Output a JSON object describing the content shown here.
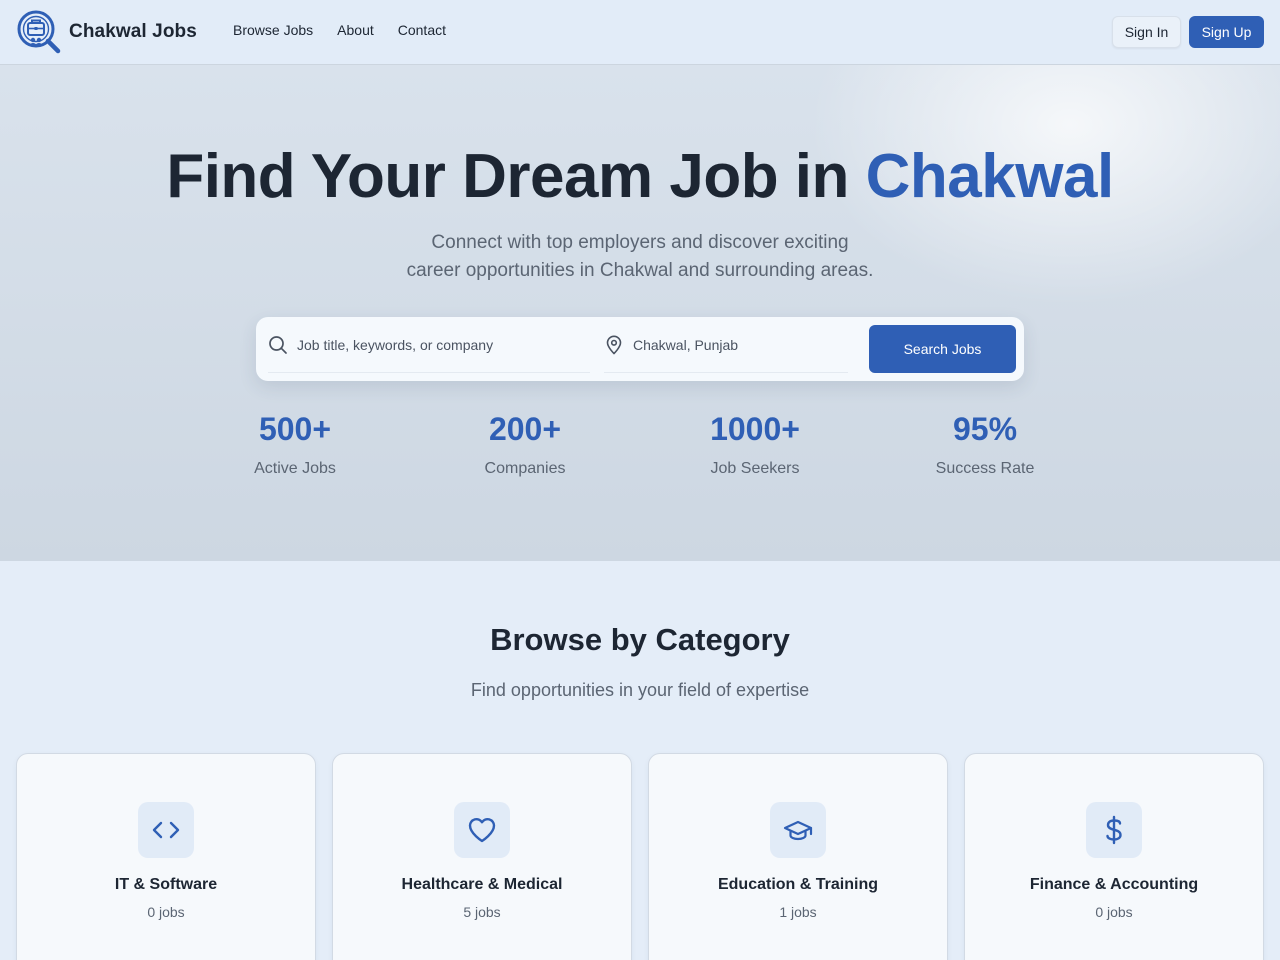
{
  "colors": {
    "accent": "#2f5fb5",
    "heading": "#1d2633",
    "muted": "#5b6573",
    "page_bg": "#e4edf8"
  },
  "header": {
    "brand": "Chakwal Jobs",
    "logo_icon": "briefcase-search-icon",
    "nav": [
      {
        "label": "Browse Jobs"
      },
      {
        "label": "About"
      },
      {
        "label": "Contact"
      }
    ],
    "sign_in": "Sign In",
    "sign_up": "Sign Up"
  },
  "hero": {
    "title_prefix": "Find Your Dream Job in ",
    "title_accent": "Chakwal",
    "subtitle_line1": "Connect with top employers and discover exciting",
    "subtitle_line2": "career opportunities in Chakwal and surrounding areas.",
    "search": {
      "keyword_placeholder": "Job title, keywords, or company",
      "keyword_icon": "search-icon",
      "location_value": "Chakwal, Punjab",
      "location_icon": "map-pin-icon",
      "button": "Search Jobs"
    },
    "stats": [
      {
        "value": "500+",
        "label": "Active Jobs"
      },
      {
        "value": "200+",
        "label": "Companies"
      },
      {
        "value": "1000+",
        "label": "Job Seekers"
      },
      {
        "value": "95%",
        "label": "Success Rate"
      }
    ]
  },
  "categories": {
    "title": "Browse by Category",
    "subtitle": "Find opportunities in your field of expertise",
    "items": [
      {
        "title": "IT & Software",
        "count": "0 jobs",
        "icon": "code-icon"
      },
      {
        "title": "Healthcare & Medical",
        "count": "5 jobs",
        "icon": "heart-icon"
      },
      {
        "title": "Education & Training",
        "count": "1 jobs",
        "icon": "graduation-cap-icon"
      },
      {
        "title": "Finance & Accounting",
        "count": "0 jobs",
        "icon": "dollar-icon"
      }
    ]
  }
}
